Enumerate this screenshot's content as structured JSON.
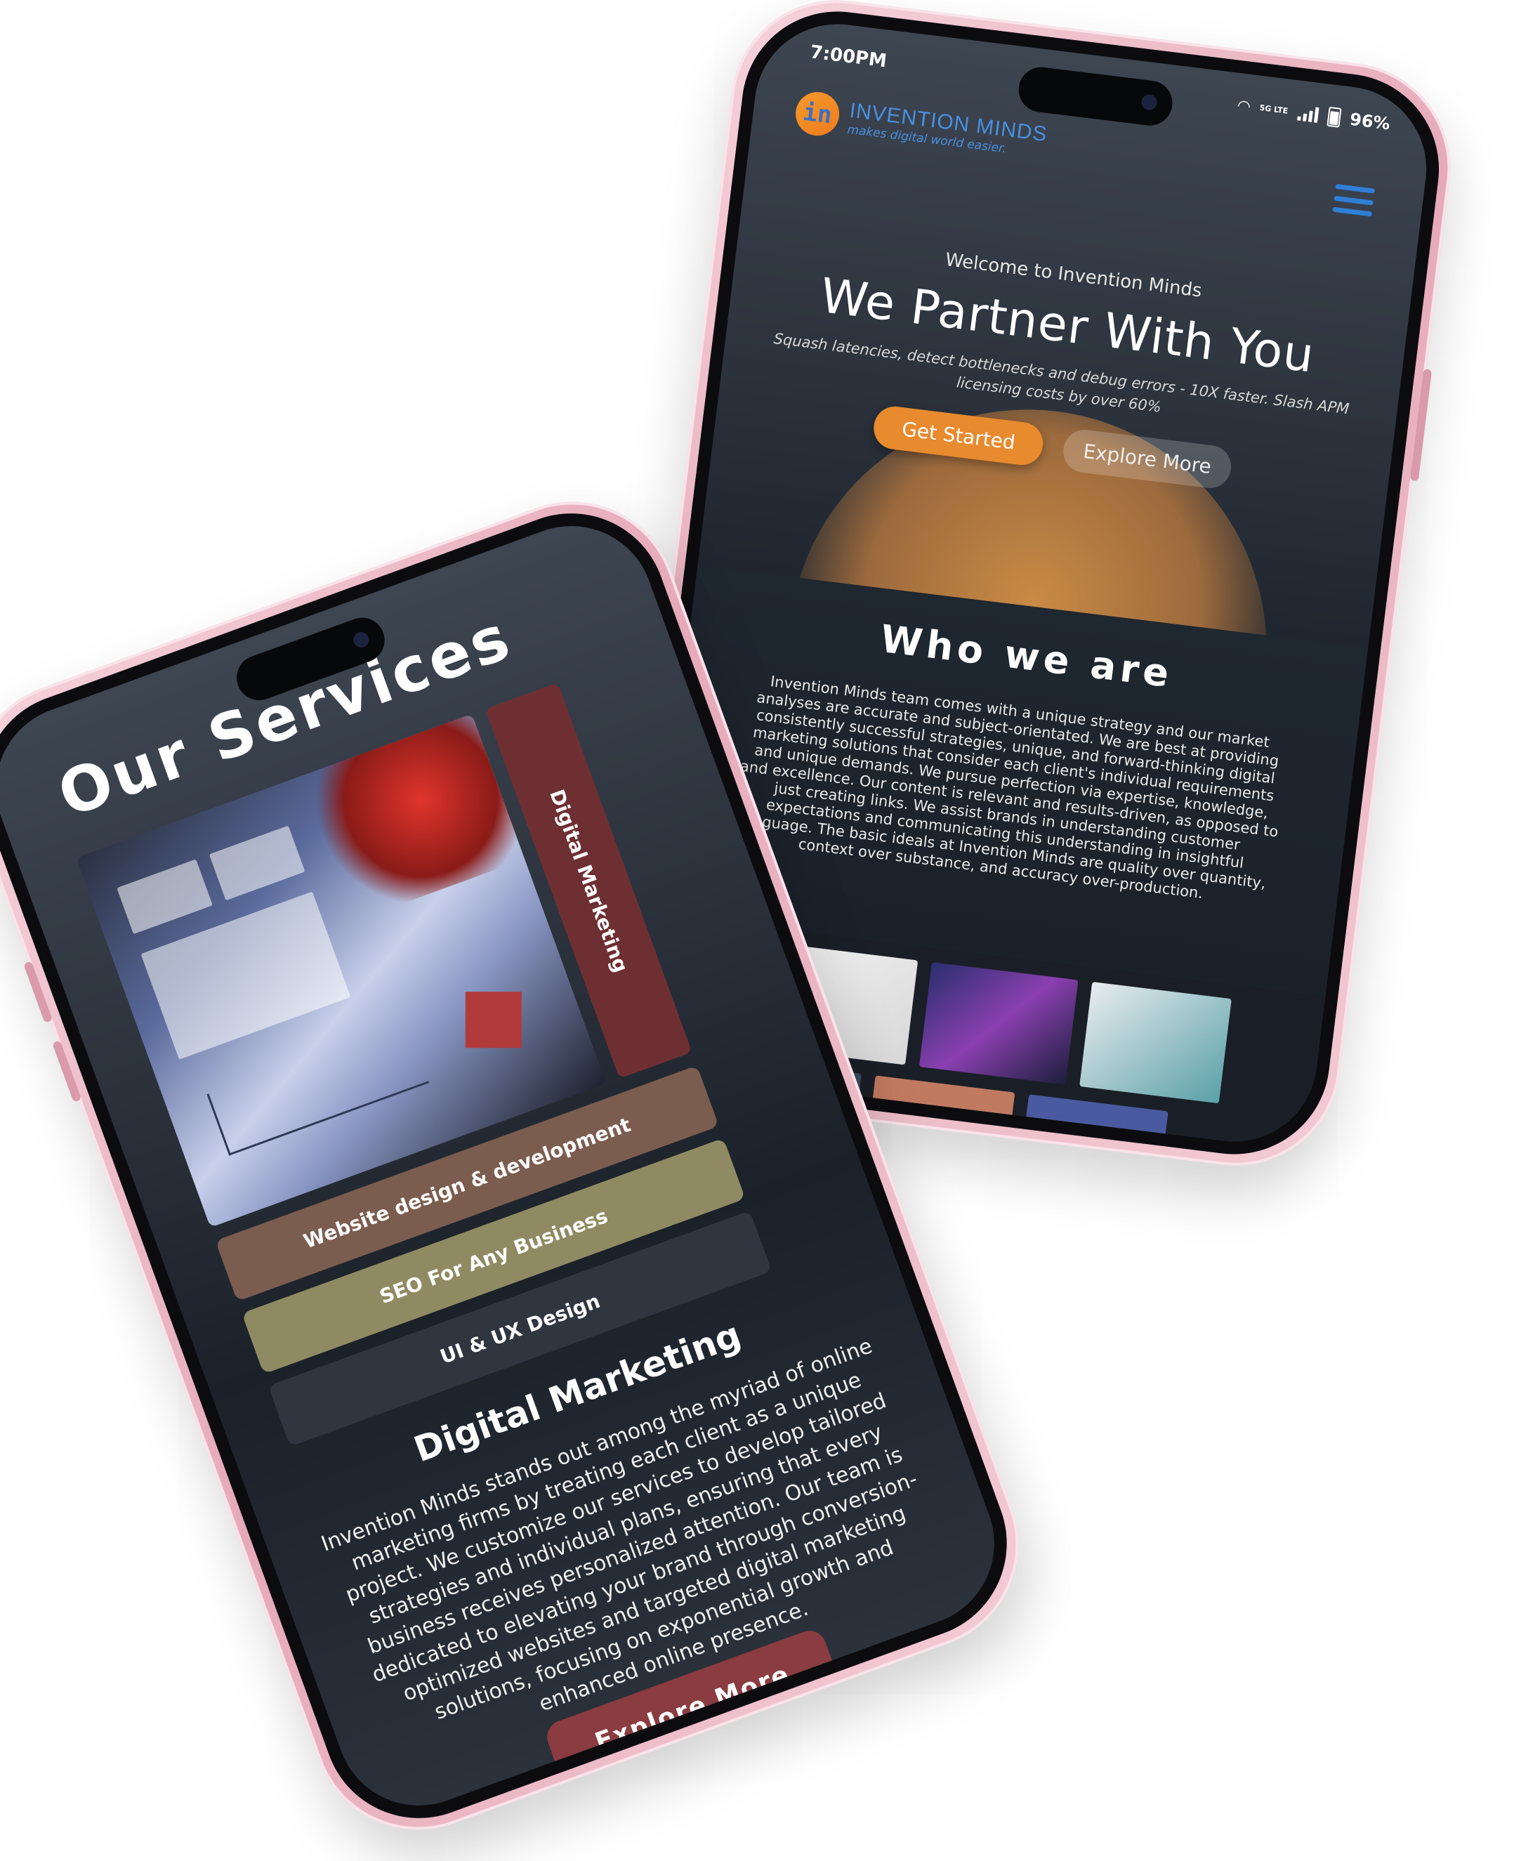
{
  "home_screen": {
    "status_bar": {
      "time": "7:00PM",
      "network_label": "5G LTE",
      "battery": "96%"
    },
    "logo": {
      "title": "INVENTION MINDS",
      "tagline": "makes digital world easier."
    },
    "hero": {
      "welcome": "Welcome to Invention Minds",
      "headline": "We Partner With You",
      "subtext": "Squash latencies, detect bottlenecks and debug errors - 10X faster. Slash APM licensing costs by over 60%",
      "primary_button": "Get Started",
      "secondary_button": "Explore More"
    },
    "who_we_are": {
      "heading": "Who we are",
      "body": "Invention Minds team comes with a unique strategy and our market analyses are accurate and subject-orientated. We are best at providing consistently successful strategies, unique, and forward-thinking digital marketing solutions that consider each client's individual requirements and unique demands. We pursue perfection via expertise, knowledge, and excellence. Our content is relevant and results-driven, as opposed to just creating links. We assist brands in understanding customer expectations and communicating this understanding in insightful language. The basic ideals at Invention Minds are quality over quantity, context over substance, and accuracy over-production."
    }
  },
  "services_screen": {
    "title": "Our Services",
    "vertical_tab": "Digital Marketing",
    "service_buttons": {
      "web": "Website design & development",
      "seo": "SEO For Any Business",
      "ux": "UI & UX Design"
    },
    "detail": {
      "heading": "Digital Marketing",
      "body": "Invention Minds stands out among the myriad of online marketing firms by treating each client as a unique project. We customize our services to develop tailored strategies and individual plans, ensuring that every business receives personalized attention. Our team is dedicated to elevating your brand through conversion-optimized websites and targeted digital marketing solutions, focusing on exponential growth and enhanced online presence.",
      "button": "Explore More"
    }
  },
  "colors": {
    "accent_orange": "#e88a2e",
    "brand_blue": "#4a8fe0",
    "tab_maroon": "#6e2f33",
    "frame_pink": "#e6a9b9"
  },
  "icons": [
    "wifi-icon",
    "signal-icon",
    "battery-icon",
    "menu-icon"
  ]
}
